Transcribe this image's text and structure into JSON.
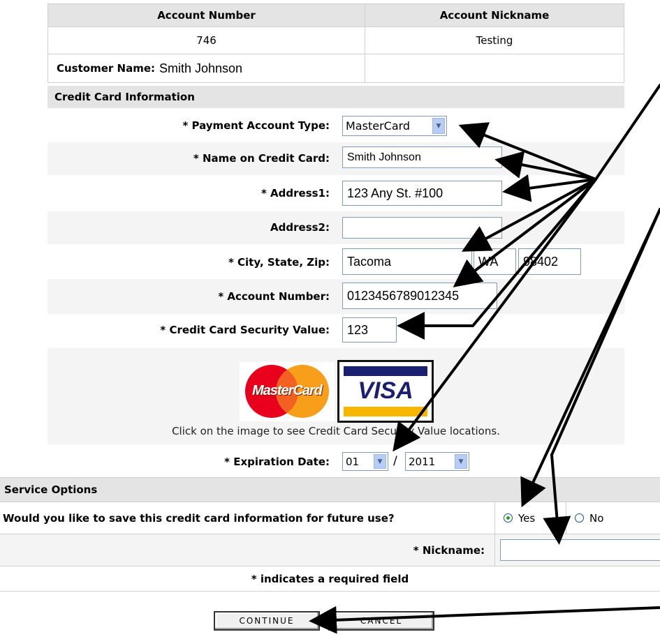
{
  "account_table": {
    "col1_header": "Account Number",
    "col2_header": "Account Nickname",
    "account_number": "746",
    "account_nickname": "Testing",
    "customer_name_label": "Customer Name:",
    "customer_name": "Smith Johnson"
  },
  "credit_card": {
    "section_title": "Credit Card Information",
    "payment_type_label": "* Payment Account Type:",
    "payment_type_value": "MasterCard",
    "name_label": "* Name on Credit Card:",
    "name_value": "Smith Johnson",
    "address1_label": "* Address1:",
    "address1_value": "123 Any St. #100",
    "address2_label": "Address2:",
    "address2_value": "",
    "city_label": "* City, State, Zip:",
    "city_value": "Tacoma",
    "state_value": "WA",
    "zip_value": "98402",
    "account_number_label": "* Account Number:",
    "account_number_value": "0123456789012345",
    "security_label": "* Credit Card Security Value:",
    "security_value": "123",
    "mastercard_logo_text": "MasterCard",
    "visa_logo_text": "VISA",
    "image_hint": "Click on the image to see Credit Card Security Value locations.",
    "expiration_label": "* Expiration Date:",
    "expiration_month": "01",
    "expiration_separator": "/",
    "expiration_year": "2011"
  },
  "service_options": {
    "section_title": "Service Options",
    "save_question": "Would you like to save this credit card information for future use?",
    "yes_label": "Yes",
    "no_label": "No",
    "nickname_label": "* Nickname:",
    "nickname_value": "",
    "required_note": "* indicates a required field"
  },
  "buttons": {
    "continue_label": "CONTINUE",
    "cancel_label": "CANCEL"
  },
  "colors": {
    "header_bg": "#e4e4e4",
    "input_border": "#7f9db9",
    "mastercard_red": "#e8001c",
    "mastercard_orange": "#f79e1b",
    "visa_blue": "#1a1f71",
    "visa_gold": "#f7b600"
  }
}
